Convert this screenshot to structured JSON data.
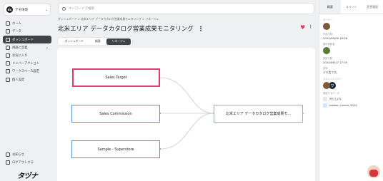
{
  "org": {
    "initial": "dx",
    "name": "デモ環境"
  },
  "nav": [
    {
      "label": "ホーム",
      "active": false
    },
    {
      "label": "データ",
      "active": false
    },
    {
      "label": "ダッシュボード",
      "active": true
    },
    {
      "label": "用語と定義",
      "active": false
    },
    {
      "label": "お気に入り",
      "active": false
    },
    {
      "label": "メンバーアクション",
      "active": false
    },
    {
      "label": "ワークスペース設定",
      "active": false
    },
    {
      "label": "個人設定",
      "active": false
    }
  ],
  "nav_bottom": [
    {
      "label": "お知らせ"
    },
    {
      "label": "ログアウトする"
    }
  ],
  "brand": "タヅナ",
  "search": {
    "placeholder": "キーワードで検索"
  },
  "breadcrumb": "ダッシュボード  >  北米エリア データカタログ営業成果モニタリング  >  リネージュ",
  "page_title": "北米エリア データカタログ営業成果モニタリング",
  "tabs": [
    {
      "label": "ダッシュボード",
      "active": false
    },
    {
      "label": "概要",
      "active": false
    },
    {
      "label": "リネージュ",
      "active": true
    }
  ],
  "lineage": {
    "sources": [
      "Sales Target",
      "Sales Commission",
      "Sample - Superstore"
    ],
    "target": "北米エリア データカタログ営業成果モ..."
  },
  "right_panel": {
    "tabs": [
      {
        "label": "概要",
        "active": true
      },
      {
        "label": "コメント",
        "active": false
      },
      {
        "label": "変更履歴",
        "active": false
      }
    ],
    "owner_label": "オーナー",
    "created_label": "作成日時",
    "created_value": "2024/06/06 16:58",
    "updated_by_label": "最終更新者",
    "updated_label": "更新日時",
    "updated_value": "2024/06/17 17:05",
    "desc_label": "説明",
    "desc_value": "デモ用です。",
    "members_label": "コメントメンバー",
    "related_label": "関連するデータ",
    "related": [
      "売り上げ2",
      "tableau_names_2024"
    ]
  }
}
